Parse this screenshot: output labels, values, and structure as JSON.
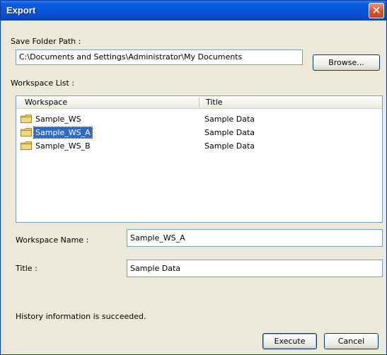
{
  "window": {
    "title": "Export",
    "close_glyph": "✕"
  },
  "save_folder": {
    "label": "Save Folder Path :",
    "value": "C:\\Documents and Settings\\Administrator\\My Documents",
    "browse_label": "Browse..."
  },
  "workspace_list": {
    "label": "Workspace List :",
    "columns": [
      "Workspace",
      "Title"
    ],
    "rows": [
      {
        "workspace": "Sample_WS",
        "title": "Sample Data",
        "icon": "folder-icon",
        "selected": false
      },
      {
        "workspace": "Sample_WS_A",
        "title": "Sample Data",
        "icon": "folder-icon",
        "selected": true
      },
      {
        "workspace": "Sample_WS_B",
        "title": "Sample Data",
        "icon": "folder-icon",
        "selected": false
      }
    ]
  },
  "workspace_name": {
    "label": "Workspace Name :",
    "value": "Sample_WS_A"
  },
  "title_field": {
    "label": "Title :",
    "value": "Sample Data"
  },
  "status": {
    "text": "History information is succeeded."
  },
  "buttons": {
    "execute": "Execute",
    "cancel": "Cancel"
  },
  "colors": {
    "titlebar": "#0a53d6",
    "selection": "#316ac5",
    "face": "#ece9d8",
    "close": "#d8522e"
  }
}
